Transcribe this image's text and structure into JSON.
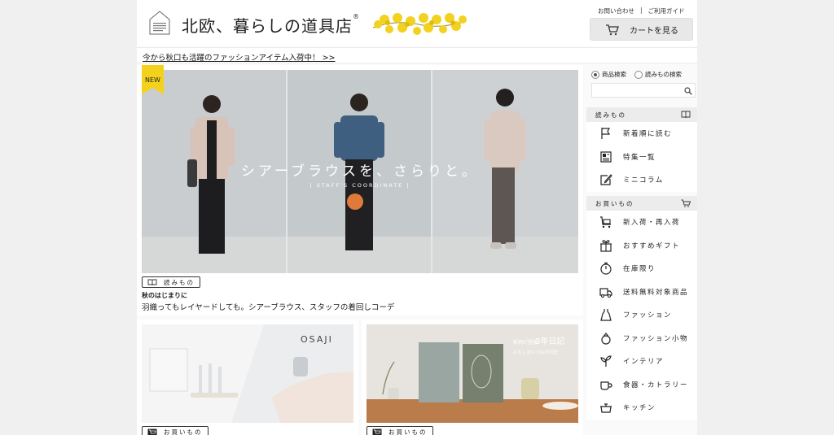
{
  "header": {
    "brand": "北欧、暮らしの道具店",
    "reg": "®",
    "contact": "お問い合わせ",
    "separator": "|",
    "guide": "ご利用ガイド",
    "cart": "カートを見る"
  },
  "notice": "今から秋口も活躍のファッションアイテム入荷中！ >>",
  "hero": {
    "badge": "NEW",
    "caption": "シアーブラウスを、さらりと。",
    "subcaption": "| STAFF'S COORDINATE |",
    "tag": "読みもの",
    "small_title": "秋のはじまりに",
    "desc": "羽織ってもレイヤードしても。シアーブラウス、スタッフの着回しコーデ"
  },
  "cards": [
    {
      "brand_text": "OSAJI",
      "tag": "お買いもの"
    },
    {
      "book_text": "3年日記",
      "badge_text": "新柄が登場",
      "sub_text": "わたしのいつもの日記",
      "tag": "お買いもの"
    }
  ],
  "sidebar": {
    "radio_products": "商品検索",
    "radio_articles": "読みもの検索",
    "section_read": "読みもの",
    "read_items": [
      "新着順に読む",
      "特集一覧",
      "ミニコラム"
    ],
    "section_shop": "お買いもの",
    "shop_items": [
      "新入荷・再入荷",
      "おすすめギフト",
      "在庫限り",
      "送料無料対象商品",
      "ファッション",
      "ファッション小物",
      "インテリア",
      "食器・カトラリー",
      "キッチン"
    ]
  },
  "colors": {
    "badge": "#f4d21c",
    "sidebar_section": "#ececec"
  }
}
